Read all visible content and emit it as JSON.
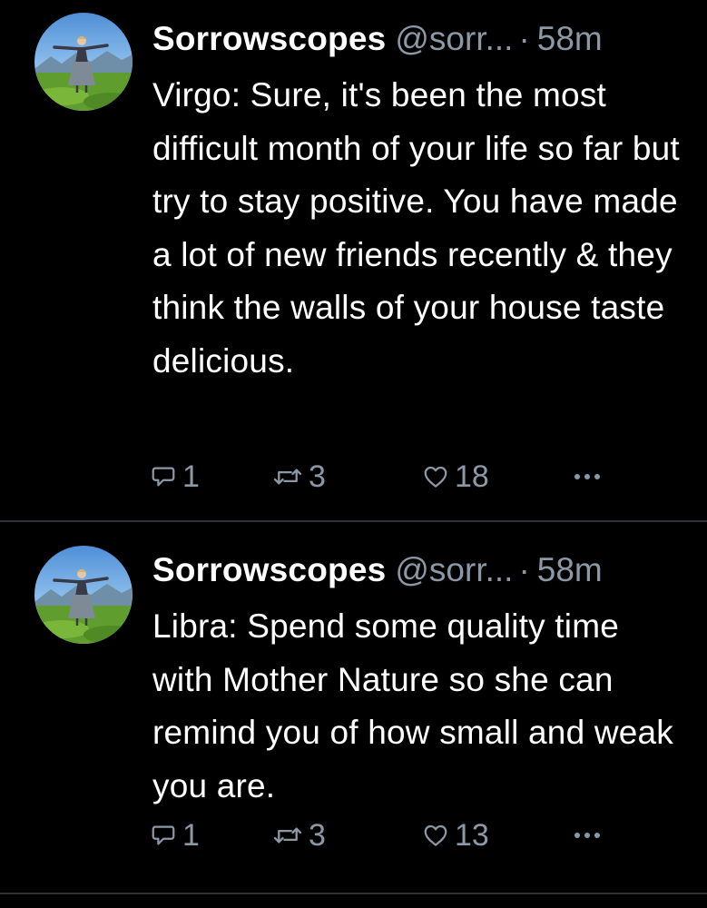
{
  "tweets": [
    {
      "display_name": "Sorrowscopes",
      "handle": "@sorr...",
      "separator": "·",
      "time": "58m",
      "text": "Virgo: Sure, it's been the most difficult month of your life so far but try to stay positive. You have made a lot of new friends recently & they think the walls of your house taste delicious.",
      "replies": "1",
      "retweets": "3",
      "likes": "18",
      "icons": {
        "reply": "reply-icon",
        "retweet": "retweet-icon",
        "like": "heart-icon",
        "more": "more-icon"
      }
    },
    {
      "display_name": "Sorrowscopes",
      "handle": "@sorr...",
      "separator": "·",
      "time": "58m",
      "text": "Libra: Spend some quality time with Mother Nature so she can remind you of how small and weak you are.",
      "replies": "1",
      "retweets": "3",
      "likes": "13",
      "icons": {
        "reply": "reply-icon",
        "retweet": "retweet-icon",
        "like": "heart-icon",
        "more": "more-icon"
      }
    }
  ],
  "colors": {
    "background": "#000000",
    "text": "#ffffff",
    "secondary_text": "#8b98a5",
    "divider": "#2f3336"
  }
}
